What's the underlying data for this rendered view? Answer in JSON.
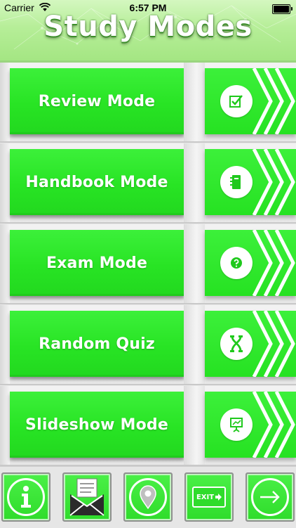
{
  "status_bar": {
    "carrier": "Carrier",
    "time": "6:57 PM"
  },
  "header": {
    "title": "Study Modes"
  },
  "modes": [
    {
      "label": "Review Mode",
      "icon": "checkbox-icon"
    },
    {
      "label": "Handbook Mode",
      "icon": "notebook-icon"
    },
    {
      "label": "Exam Mode",
      "icon": "question-icon"
    },
    {
      "label": "Random Quiz",
      "icon": "shuffle-icon"
    },
    {
      "label": "Slideshow Mode",
      "icon": "presentation-icon"
    }
  ],
  "toolbar": {
    "info_icon": "info-icon",
    "mail_icon": "mail-icon",
    "location_icon": "location-pin-icon",
    "exit_label": "EXIT",
    "next_icon": "arrow-right-icon"
  },
  "colors": {
    "accent_green": "#2ee42a",
    "header_green": "#b6ee98",
    "background": "#e8e8e8"
  }
}
